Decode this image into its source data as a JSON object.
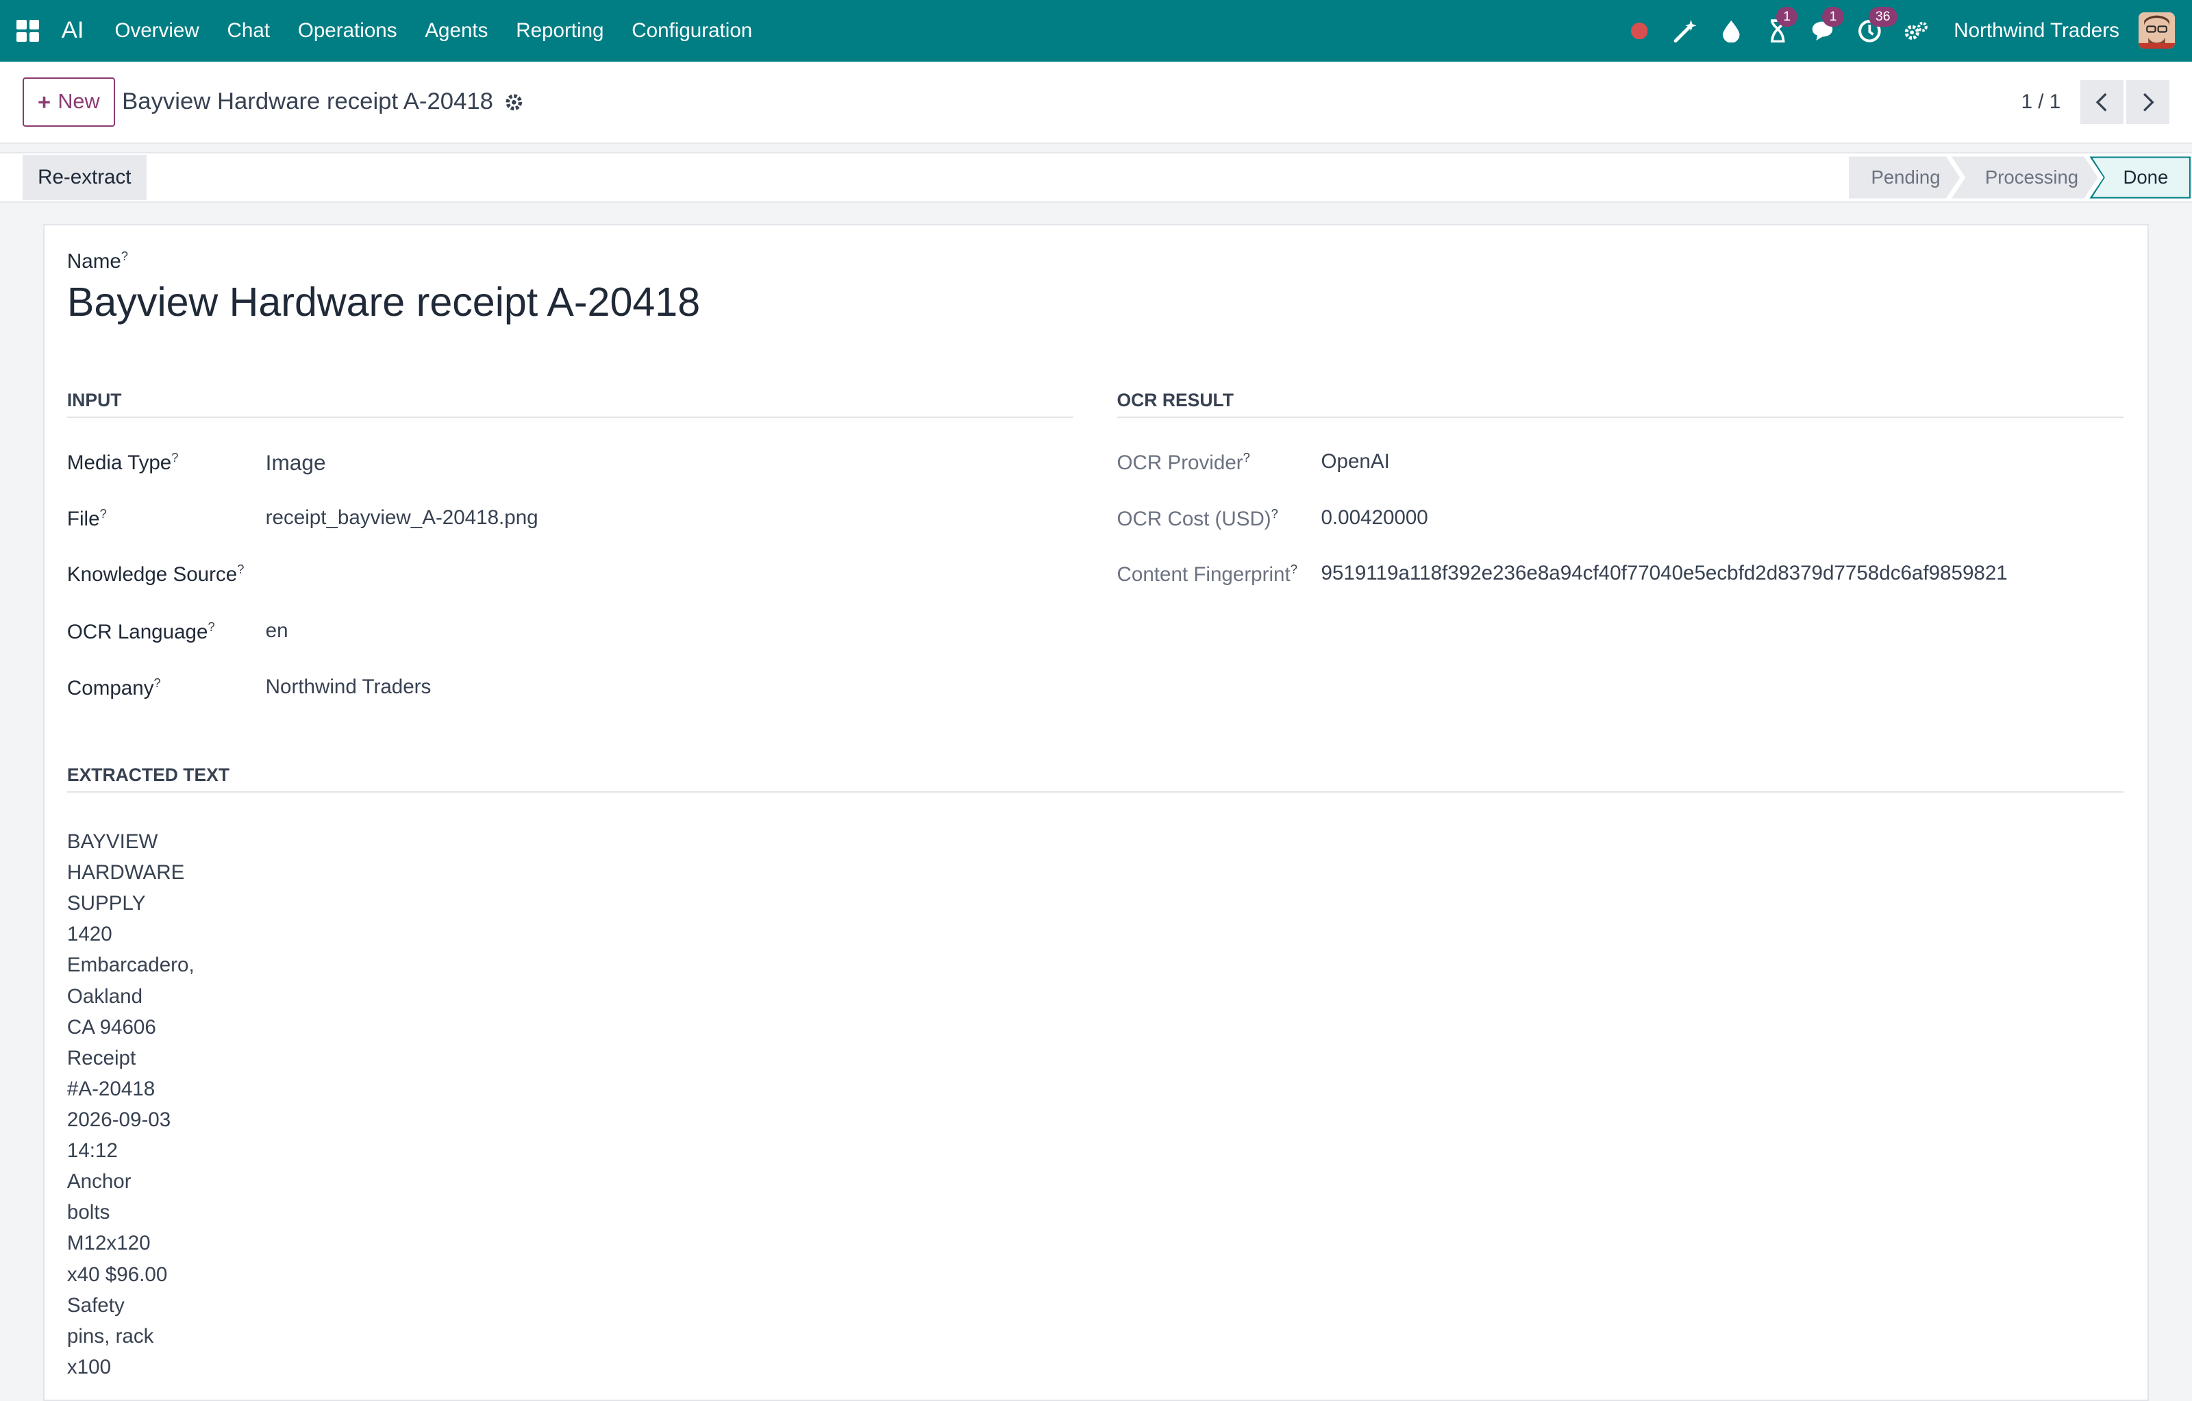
{
  "topbar": {
    "app_name": "AI",
    "menu": [
      "Overview",
      "Chat",
      "Operations",
      "Agents",
      "Reporting",
      "Configuration"
    ],
    "badges": {
      "activity": "1",
      "messages": "1",
      "clock": "36"
    },
    "company": "Northwind Traders",
    "colors": {
      "bar": "#017e84",
      "badge": "#8b3a72",
      "record_dot": "#d94f4f"
    }
  },
  "control": {
    "new_label": "New",
    "record_title": "Bayview Hardware receipt A-20418",
    "pager": "1 / 1"
  },
  "actions": {
    "reextract_label": "Re-extract"
  },
  "statusbar": {
    "stages": [
      "Pending",
      "Processing",
      "Done"
    ],
    "current": "Done"
  },
  "form": {
    "name_label": "Name",
    "name_value": "Bayview Hardware receipt A-20418",
    "input": {
      "title": "INPUT",
      "media_type_label": "Media Type",
      "media_type": "Image",
      "file_label": "File",
      "file": "receipt_bayview_A-20418.png",
      "knowledge_source_label": "Knowledge Source",
      "knowledge_source": "",
      "ocr_language_label": "OCR Language",
      "ocr_language": "en",
      "company_label": "Company",
      "company": "Northwind Traders"
    },
    "ocr_result": {
      "title": "OCR RESULT",
      "provider_label": "OCR Provider",
      "provider": "OpenAI",
      "cost_label": "OCR Cost (USD)",
      "cost": "0.00420000",
      "fingerprint_label": "Content Fingerprint",
      "fingerprint": "9519119a118f392e236e8a94cf40f77040e5ecbfd2d8379d7758dc6af9859821"
    },
    "extracted": {
      "title": "EXTRACTED TEXT",
      "text": "BAYVIEW\nHARDWARE\nSUPPLY\n1420\nEmbarcadero,\nOakland\nCA 94606\nReceipt\n#A-20418\n2026-09-03\n14:12\nAnchor\nbolts\nM12x120\nx40 $96.00\nSafety\npins, rack\nx100"
    }
  }
}
